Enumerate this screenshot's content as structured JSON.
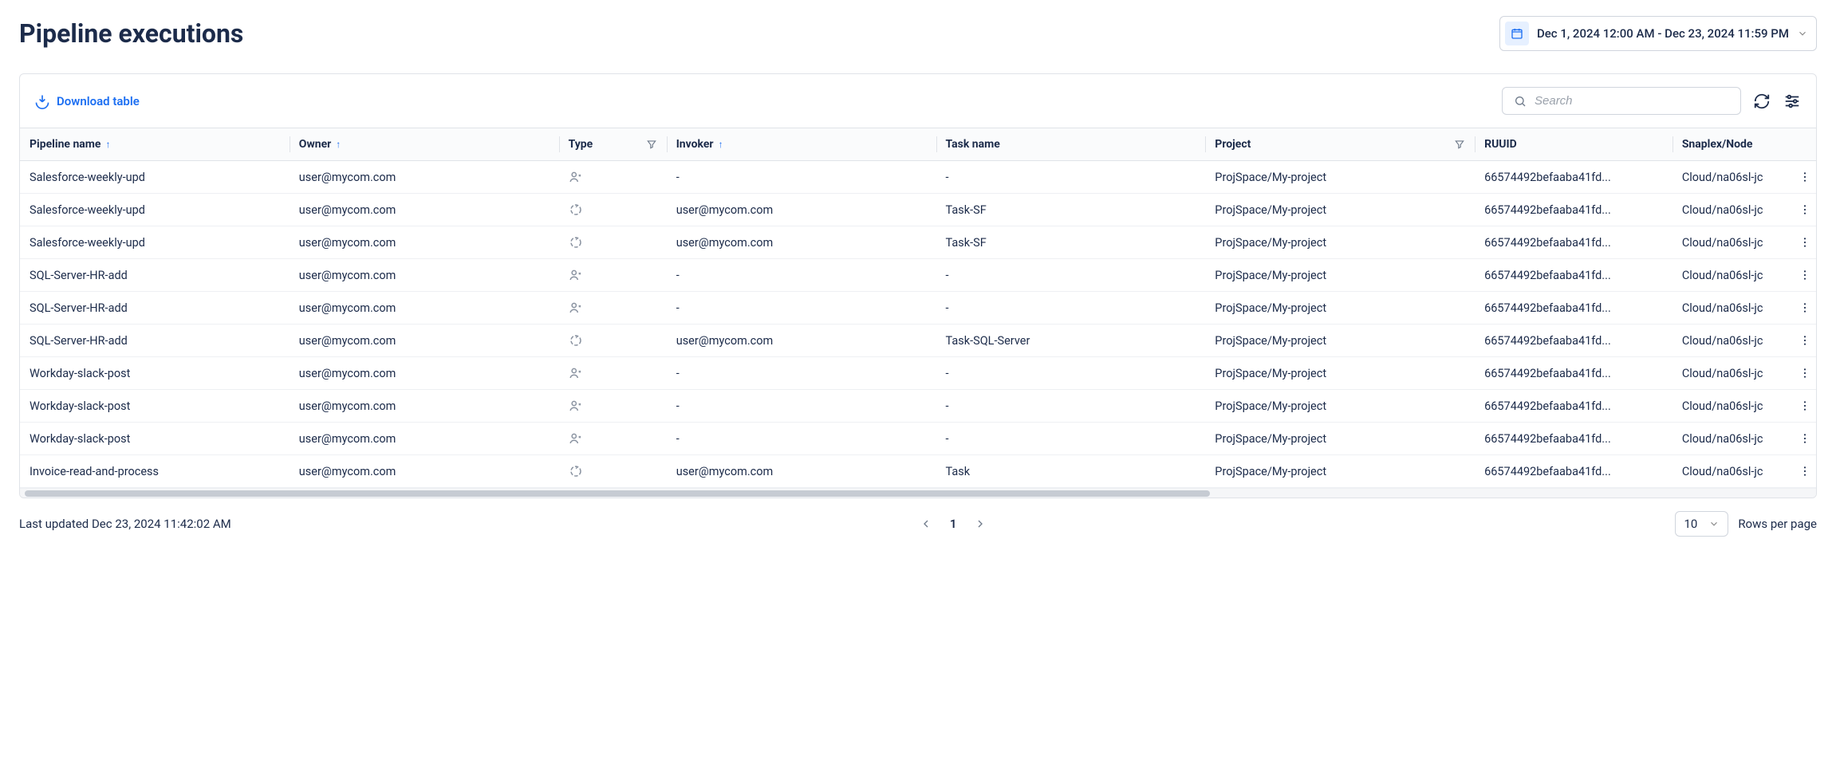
{
  "header": {
    "title": "Pipeline executions",
    "date_range": "Dec 1, 2024 12:00 AM - Dec 23, 2024 11:59 PM"
  },
  "toolbar": {
    "download_label": "Download table",
    "search_placeholder": "Search"
  },
  "columns": {
    "pipeline_name": "Pipeline name",
    "owner": "Owner",
    "type": "Type",
    "invoker": "Invoker",
    "task_name": "Task name",
    "project": "Project",
    "ruuid": "RUUID",
    "snaplex": "Snaplex/Node"
  },
  "rows": [
    {
      "pipeline": "Salesforce-weekly-upd",
      "owner": "user@mycom.com",
      "type": "user",
      "invoker": "-",
      "task": "-",
      "project": "ProjSpace/My-project",
      "ruuid": "66574492befaaba41fd...",
      "snaplex": "Cloud/na06sl-jc"
    },
    {
      "pipeline": "Salesforce-weekly-upd",
      "owner": "user@mycom.com",
      "type": "auto",
      "invoker": "user@mycom.com",
      "task": "Task-SF",
      "project": "ProjSpace/My-project",
      "ruuid": "66574492befaaba41fd...",
      "snaplex": "Cloud/na06sl-jc"
    },
    {
      "pipeline": "Salesforce-weekly-upd",
      "owner": "user@mycom.com",
      "type": "auto",
      "invoker": "user@mycom.com",
      "task": "Task-SF",
      "project": "ProjSpace/My-project",
      "ruuid": "66574492befaaba41fd...",
      "snaplex": "Cloud/na06sl-jc"
    },
    {
      "pipeline": "SQL-Server-HR-add",
      "owner": "user@mycom.com",
      "type": "user",
      "invoker": "-",
      "task": "-",
      "project": "ProjSpace/My-project",
      "ruuid": "66574492befaaba41fd...",
      "snaplex": "Cloud/na06sl-jc"
    },
    {
      "pipeline": "SQL-Server-HR-add",
      "owner": "user@mycom.com",
      "type": "user",
      "invoker": "-",
      "task": "-",
      "project": "ProjSpace/My-project",
      "ruuid": "66574492befaaba41fd...",
      "snaplex": "Cloud/na06sl-jc"
    },
    {
      "pipeline": "SQL-Server-HR-add",
      "owner": "user@mycom.com",
      "type": "auto",
      "invoker": "user@mycom.com",
      "task": "Task-SQL-Server",
      "project": "ProjSpace/My-project",
      "ruuid": "66574492befaaba41fd...",
      "snaplex": "Cloud/na06sl-jc"
    },
    {
      "pipeline": "Workday-slack-post",
      "owner": "user@mycom.com",
      "type": "user",
      "invoker": "-",
      "task": "-",
      "project": "ProjSpace/My-project",
      "ruuid": "66574492befaaba41fd...",
      "snaplex": "Cloud/na06sl-jc"
    },
    {
      "pipeline": "Workday-slack-post",
      "owner": "user@mycom.com",
      "type": "user",
      "invoker": "-",
      "task": "-",
      "project": "ProjSpace/My-project",
      "ruuid": "66574492befaaba41fd...",
      "snaplex": "Cloud/na06sl-jc"
    },
    {
      "pipeline": "Workday-slack-post",
      "owner": "user@mycom.com",
      "type": "user",
      "invoker": "-",
      "task": "-",
      "project": "ProjSpace/My-project",
      "ruuid": "66574492befaaba41fd...",
      "snaplex": "Cloud/na06sl-jc"
    },
    {
      "pipeline": "Invoice-read-and-process",
      "owner": "user@mycom.com",
      "type": "auto",
      "invoker": "user@mycom.com",
      "task": "Task",
      "project": "ProjSpace/My-project",
      "ruuid": "66574492befaaba41fd...",
      "snaplex": "Cloud/na06sl-jc"
    }
  ],
  "footer": {
    "last_updated": "Last updated Dec 23, 2024 11:42:02 AM",
    "page": "1",
    "rows_per_page_value": "10",
    "rows_per_page_label": "Rows per page"
  }
}
